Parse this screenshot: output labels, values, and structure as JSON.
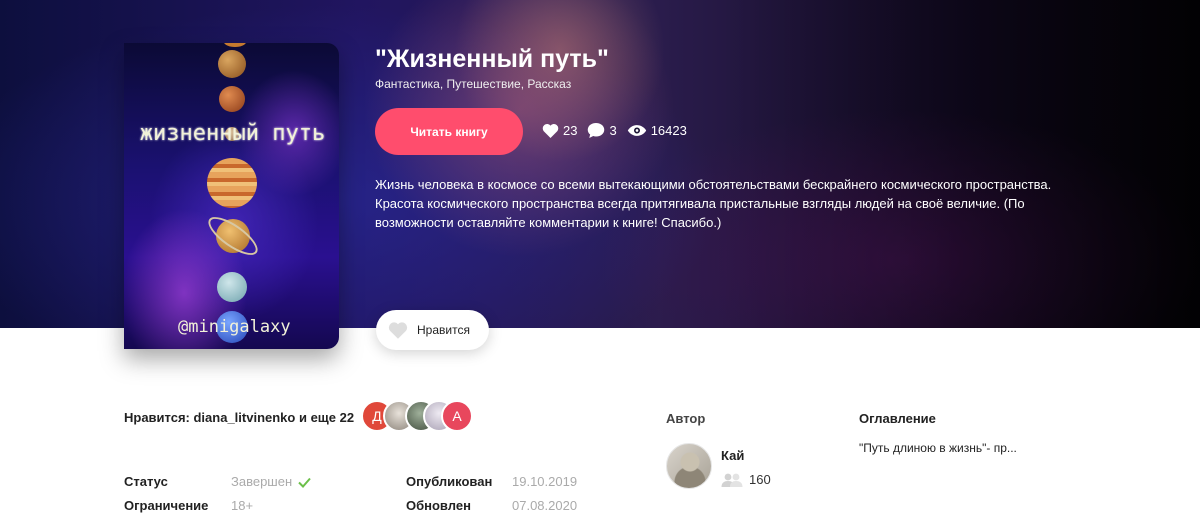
{
  "book": {
    "title": "\"Жизненный путь\"",
    "genres": "Фантастика, Путешествие, Рассказ",
    "read_button": "Читать книгу",
    "likes": "23",
    "comments": "3",
    "views": "16423",
    "description": "Жизнь человека в космосе со всеми вытекающими обстоятельствами бескрайнего космического пространства. Красота космического пространства всегда притягивала пристальные взгляды людей на своё величие. (По возможности оставляйте комментарии к книге! Спасибо.)",
    "like_button": "Нравится"
  },
  "cover": {
    "title": "жизненный путь",
    "handle": "@minigalaxy"
  },
  "liked_by": {
    "text": "Нравится: diana_litvinenko и еще 22",
    "avatars": [
      {
        "letter": "Д",
        "color": "#e0483a"
      },
      {
        "letter": "",
        "color": "#b8b0a6"
      },
      {
        "letter": "",
        "color": "#6d7f6a"
      },
      {
        "letter": "",
        "color": "#cfc9d4"
      },
      {
        "letter": "А",
        "color": "#e8475d"
      }
    ]
  },
  "details": {
    "status_label": "Статус",
    "status_value": "Завершен",
    "restriction_label": "Ограничение",
    "restriction_value": "18+",
    "published_label": "Опубликован",
    "published_value": "19.10.2019",
    "updated_label": "Обновлен",
    "updated_value": "07.08.2020"
  },
  "author": {
    "heading": "Автор",
    "name": "Кай",
    "followers": "160"
  },
  "toc": {
    "heading": "Оглавление",
    "items": [
      "\"Путь длиною в жизнь\"- пр..."
    ]
  },
  "colors": {
    "accent": "#ff4d6d",
    "check": "#6cc04a"
  }
}
